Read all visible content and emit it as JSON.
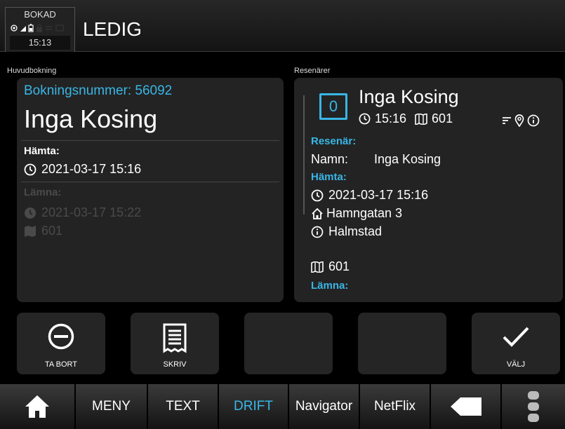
{
  "status": {
    "label": "BOKAD",
    "time": "15:13"
  },
  "header": {
    "title": "LEDIG"
  },
  "main": {
    "label": "Huvudbokning",
    "booking_number": "Bokningsnummer: 56092",
    "name": "Inga Kosing",
    "pickup_label": "Hämta:",
    "pickup_time": "2021-03-17 15:16",
    "dropoff_label": "Lämna:",
    "dropoff_time": "2021-03-17 15:22",
    "dropoff_zone": "601"
  },
  "travelers": {
    "label": "Resenärer",
    "seat": "0",
    "name": "Inga Kosing",
    "time": "15:16",
    "zone": "601",
    "traveler_label": "Resenär:",
    "name_label": "Namn:",
    "name_value": "Inga Kosing",
    "pickup_label": "Hämta:",
    "pickup_time": "2021-03-17 15:16",
    "address": "Hamngatan 3",
    "city": "Halmstad",
    "pickup_zone": "601",
    "dropoff_label": "Lämna:"
  },
  "actions": {
    "remove": "TA BORT",
    "print": "SKRIV",
    "select": "VÄLJ"
  },
  "nav": {
    "menu": "MENY",
    "text": "TEXT",
    "drift": "DRIFT",
    "navigator": "Navigator",
    "netflix": "NetFlix"
  },
  "colors": {
    "accent": "#39b6e6",
    "panel": "#232323",
    "background": "#000000"
  }
}
